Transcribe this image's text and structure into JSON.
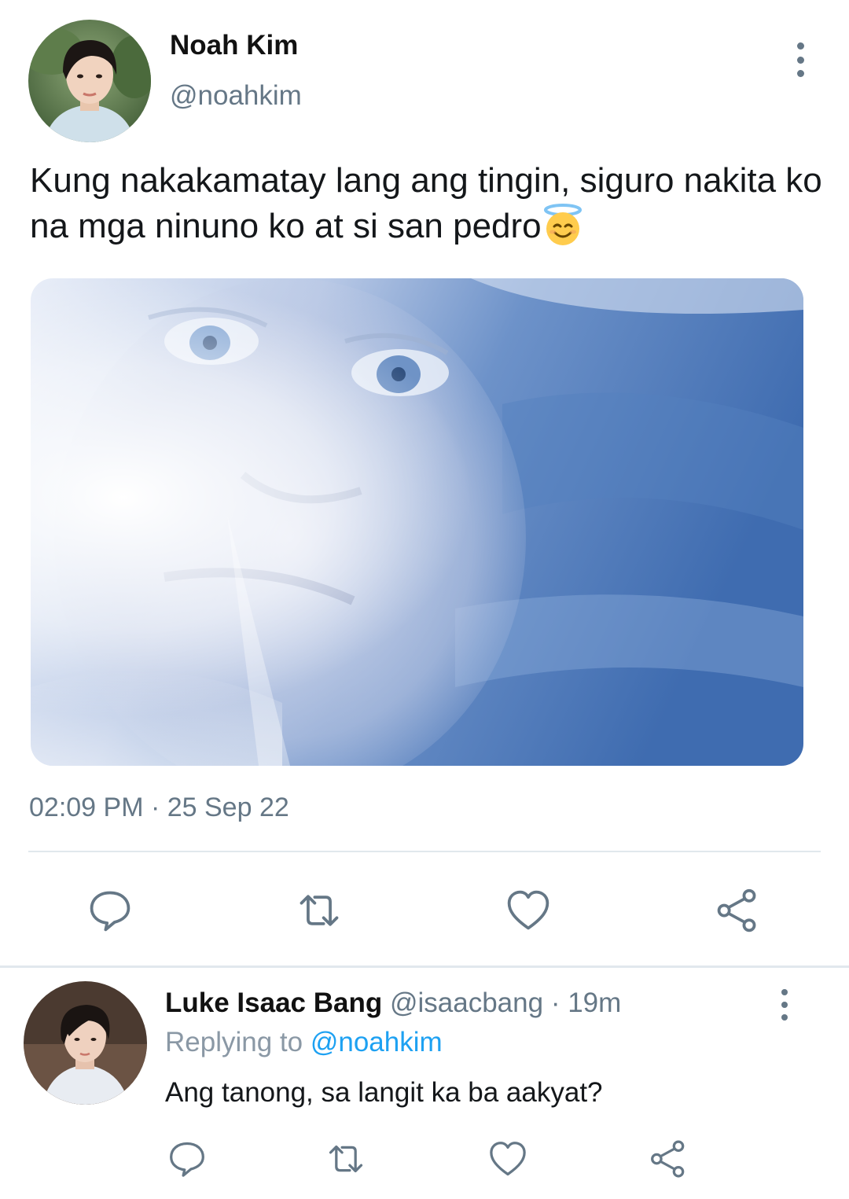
{
  "main_tweet": {
    "author_name": "Noah Kim",
    "author_handle": "@noahkim",
    "text": "Kung nakakamatay lang ang tingin, siguro nakita ko na mga ninuno ko at si san pedro",
    "emoji": "smiling-face-with-halo",
    "timestamp": "02:09 PM · 25 Sep 22",
    "actions": [
      "reply-icon",
      "retweet-icon",
      "like-icon",
      "share-icon"
    ]
  },
  "reply": {
    "author_name": "Luke Isaac Bang",
    "author_handle": "@isaacbang",
    "separator": "·",
    "time": "19m",
    "replying_label": "Replying to",
    "replying_handle": "@noahkim",
    "text": "Ang tanong, sa langit ka ba aakyat?",
    "actions": [
      "reply-icon",
      "retweet-icon",
      "like-icon",
      "share-icon"
    ]
  },
  "colors": {
    "text": "#14171a",
    "secondary": "#657786",
    "link": "#1da1f2",
    "divider": "#e1e8ed",
    "icon": "#657786"
  }
}
